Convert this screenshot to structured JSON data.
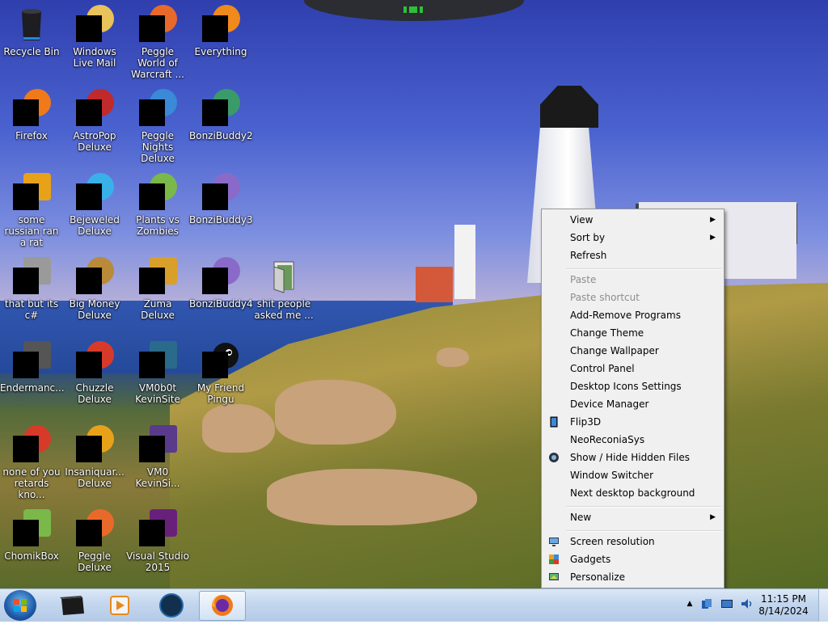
{
  "desktop": {
    "icons": [
      {
        "label": "Recycle Bin",
        "icon": "recycle-bin-icon",
        "tint": ""
      },
      {
        "label": "Windows Live Mail",
        "icon": "windows-live-mail-icon",
        "tint": "#e8c25a"
      },
      {
        "label": "Peggle World of Warcraft ...",
        "icon": "peggle-wow-icon",
        "tint": "#e86a2a"
      },
      {
        "label": "Everything",
        "icon": "everything-icon",
        "tint": "#f08a1c"
      },
      {
        "label": "Firefox",
        "icon": "firefox-icon",
        "tint": "#f07a1a"
      },
      {
        "label": "AstroPop Deluxe",
        "icon": "astropop-icon",
        "tint": "#c02a2a"
      },
      {
        "label": "Peggle Nights Deluxe",
        "icon": "peggle-nights-icon",
        "tint": "#3a8ad8"
      },
      {
        "label": "BonziBuddy2",
        "icon": "bonzibuddy-icon",
        "tint": "#3a9a6a"
      },
      {
        "label": "some russian ran a rat",
        "icon": "app-icon",
        "tint": "#e8a21a"
      },
      {
        "label": "Bejeweled Deluxe",
        "icon": "bejeweled-icon",
        "tint": "#3ab0e8"
      },
      {
        "label": "Plants vs Zombies",
        "icon": "plants-vs-zombies-icon",
        "tint": "#7ab84a"
      },
      {
        "label": "BonziBuddy3",
        "icon": "bonzibuddy-icon",
        "tint": "#8a6ac8"
      },
      {
        "label": "that but its c#",
        "icon": "app-icon",
        "tint": "#9a9a9a"
      },
      {
        "label": "Big Money Deluxe",
        "icon": "big-money-icon",
        "tint": "#b88a3a"
      },
      {
        "label": "Zuma Deluxe",
        "icon": "zuma-icon",
        "tint": "#d8a02a"
      },
      {
        "label": "BonziBuddy4",
        "icon": "bonzibuddy-icon",
        "tint": "#8a6ac8"
      },
      {
        "label": "shit people asked me ...",
        "icon": "folder-icon",
        "tint": ""
      },
      {
        "label": "Endermanc...",
        "icon": "app-icon",
        "tint": "#555555"
      },
      {
        "label": "Chuzzle Deluxe",
        "icon": "chuzzle-icon",
        "tint": "#d83a2a"
      },
      {
        "label": "VM0b0t KevinSite",
        "icon": "app-icon",
        "tint": "#2a6a8a"
      },
      {
        "label": "My Friend Pingu",
        "icon": "pingu-icon",
        "tint": "#111111"
      },
      {
        "label": "none of you retards kno...",
        "icon": "app-icon",
        "tint": "#d83a2a"
      },
      {
        "label": "Insaniquar... Deluxe",
        "icon": "insaniquarium-icon",
        "tint": "#e8a21a"
      },
      {
        "label": "VM0 KevinSi...",
        "icon": "app-icon",
        "tint": "#5a3a8a"
      },
      {
        "label": "ChomikBox",
        "icon": "chomikbox-icon",
        "tint": "#7ab84a"
      },
      {
        "label": "Peggle Deluxe",
        "icon": "peggle-icon",
        "tint": "#e86a2a"
      },
      {
        "label": "Visual Studio 2015",
        "icon": "visual-studio-icon",
        "tint": "#68217a"
      }
    ]
  },
  "context_menu": {
    "view": "View",
    "sort_by": "Sort by",
    "refresh": "Refresh",
    "paste": "Paste",
    "paste_shortcut": "Paste shortcut",
    "add_remove": "Add-Remove Programs",
    "change_theme": "Change Theme",
    "change_wallpaper": "Change Wallpaper",
    "control_panel": "Control Panel",
    "desktop_icons_settings": "Desktop Icons Settings",
    "device_manager": "Device Manager",
    "flip3d": "Flip3D",
    "neoreconiasys": "NeoReconiaSys",
    "show_hide": "Show / Hide Hidden Files",
    "window_switcher": "Window Switcher",
    "next_background": "Next desktop background",
    "new": "New",
    "screen_resolution": "Screen resolution",
    "gadgets": "Gadgets",
    "personalize": "Personalize",
    "submenu_arrow": "▶"
  },
  "taskbar": {
    "clock_time": "11:15 PM",
    "clock_date": "8/14/2024",
    "tray_arrow": "▲",
    "colors": {
      "accent": "#1f5aa8",
      "bar": "#c3d6ee"
    }
  }
}
